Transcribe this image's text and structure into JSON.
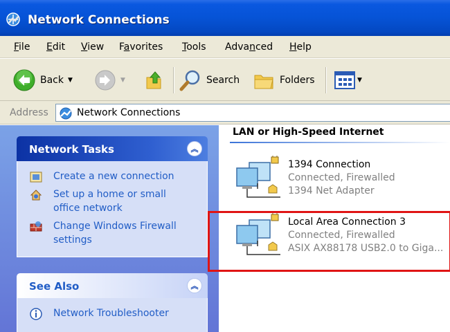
{
  "window": {
    "title": "Network Connections",
    "app_icon": "network-connections-icon"
  },
  "menu": {
    "items": [
      {
        "label": "File",
        "mnemonic": "F"
      },
      {
        "label": "Edit",
        "mnemonic": "E"
      },
      {
        "label": "View",
        "mnemonic": "V"
      },
      {
        "label": "Favorites",
        "mnemonic": "a"
      },
      {
        "label": "Tools",
        "mnemonic": "T"
      },
      {
        "label": "Advanced",
        "mnemonic": "n"
      },
      {
        "label": "Help",
        "mnemonic": "H"
      }
    ]
  },
  "toolbar": {
    "back_label": "Back",
    "search_label": "Search",
    "folders_label": "Folders",
    "icons": [
      "back-arrow-icon",
      "forward-arrow-icon",
      "up-folder-icon",
      "search-icon",
      "folders-icon",
      "views-icon"
    ]
  },
  "address": {
    "label": "Address",
    "value": "Network Connections"
  },
  "task_pane": {
    "network_tasks": {
      "title": "Network Tasks",
      "links": [
        {
          "label": "Create a new connection",
          "icon": "new-connection-icon"
        },
        {
          "label": "Set up a home or small office network",
          "icon": "home-network-icon"
        },
        {
          "label": "Change Windows Firewall settings",
          "icon": "firewall-icon"
        }
      ]
    },
    "see_also": {
      "title": "See Also",
      "links": [
        {
          "label": "Network Troubleshooter",
          "icon": "info-icon"
        }
      ]
    }
  },
  "content": {
    "group_title": "LAN or High-Speed Internet",
    "connections": [
      {
        "name": "1394 Connection",
        "status": "Connected, Firewalled",
        "device": "1394 Net Adapter"
      },
      {
        "name": "Local Area Connection 3",
        "status": "Connected, Firewalled",
        "device": "ASIX AX88178 USB2.0 to Giga...",
        "highlighted": true
      }
    ]
  },
  "colors": {
    "titlebar": "#0653d6",
    "chrome": "#ece9d8",
    "task_pane": "#7ba2e7",
    "link": "#215dc6",
    "highlight": "#e01414"
  }
}
